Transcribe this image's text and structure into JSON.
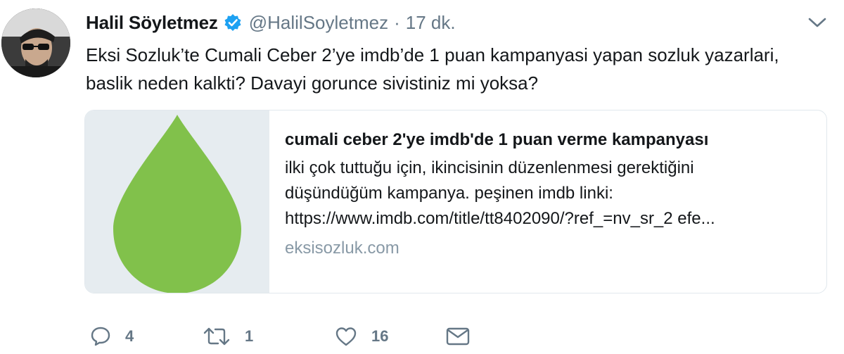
{
  "tweet": {
    "author_name": "Halil Söyletmez",
    "handle": "@HalilSoyletmez",
    "separator": "·",
    "time": "17 dk.",
    "text": "Eksi Sozluk’te Cumali Ceber 2’ye imdb’de 1 puan kampanyasi yapan sozluk yazarlari, baslik neden kalkti? Davayi gorunce sivistiniz mi yoksa?"
  },
  "card": {
    "title": "cumali ceber 2'ye imdb'de 1 puan verme kampanyası",
    "description_lines": [
      "ilki çok tuttuğu için, ikincisinin düzenlenmesi gerektiğini",
      "düşündüğüm kampanya. peşinen imdb linki:",
      "https://www.imdb.com/title/tt8402090/?ref_=nv_sr_2 efe..."
    ],
    "domain": "eksisozluk.com",
    "image_icon": "green-drop-logo"
  },
  "actions": {
    "reply_count": "4",
    "retweet_count": "1",
    "like_count": "16"
  },
  "icons": {
    "verified": "verified-badge-icon",
    "caret": "chevron-down-icon",
    "reply": "reply-icon",
    "retweet": "retweet-icon",
    "like": "heart-icon",
    "dm": "envelope-icon"
  },
  "colors": {
    "verified_blue": "#1da1f2",
    "card_drop_green": "#81c14b",
    "card_image_bg": "#e6ecf0",
    "muted_text": "#657786",
    "domain_text": "#8899a6"
  }
}
